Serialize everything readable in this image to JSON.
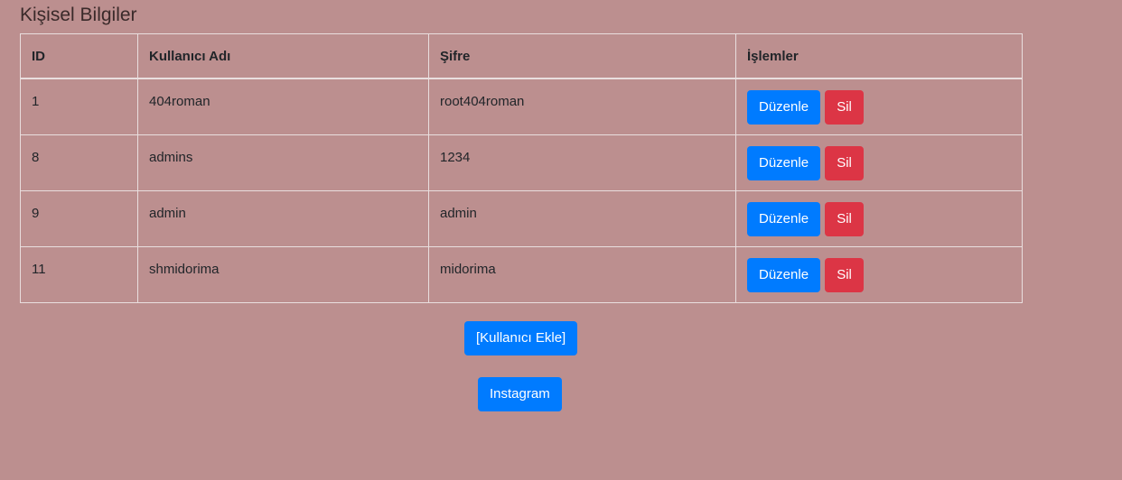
{
  "page": {
    "title": "Kişisel Bilgiler"
  },
  "table": {
    "headers": {
      "id": "ID",
      "username": "Kullanıcı Adı",
      "password": "Şifre",
      "actions": "İşlemler"
    },
    "rows": [
      {
        "id": "1",
        "username": "404roman",
        "password": "root404roman"
      },
      {
        "id": "8",
        "username": "admins",
        "password": "1234"
      },
      {
        "id": "9",
        "username": "admin",
        "password": "admin"
      },
      {
        "id": "11",
        "username": "shmidorima",
        "password": "midorima"
      }
    ],
    "edit_label": "Düzenle",
    "delete_label": "Sil"
  },
  "buttons": {
    "add_user": "[Kullanıcı Ekle]",
    "instagram": "Instagram"
  },
  "colors": {
    "background": "#bc8f8f",
    "primary": "#007bff",
    "danger": "#dc3545"
  }
}
